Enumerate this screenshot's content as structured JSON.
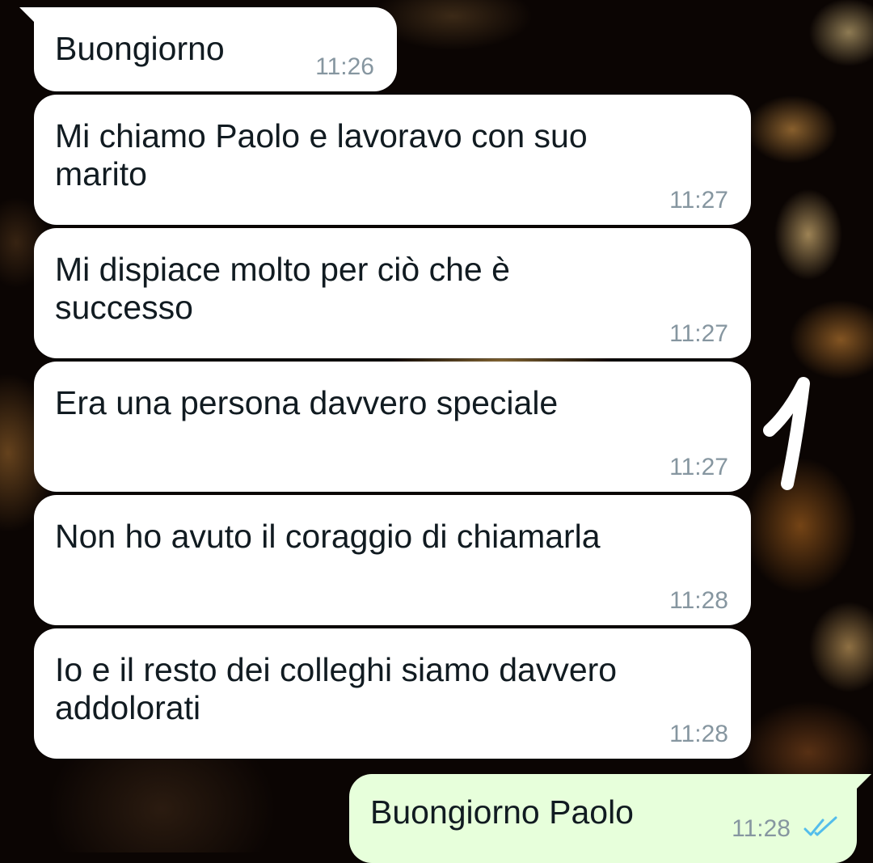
{
  "messages": [
    {
      "direction": "incoming",
      "text": "Buongiorno",
      "time": "11:26"
    },
    {
      "direction": "incoming",
      "text": "Mi chiamo Paolo e lavoravo con suo marito",
      "time": "11:27"
    },
    {
      "direction": "incoming",
      "text": "Mi dispiace molto per ciò che è successo",
      "time": "11:27"
    },
    {
      "direction": "incoming",
      "text": "Era una persona davvero speciale",
      "time": "11:27"
    },
    {
      "direction": "incoming",
      "text": "Non ho avuto il coraggio di chiamarla",
      "time": "11:28"
    },
    {
      "direction": "incoming",
      "text": "Io e il resto dei colleghi siamo davvero addolorati",
      "time": "11:28"
    },
    {
      "direction": "outgoing",
      "text": "Buongiorno Paolo",
      "time": "11:28",
      "status": "read",
      "status_icon": "double-check-icon"
    }
  ],
  "annotation": {
    "text": "1",
    "icon": "handwritten-mark"
  },
  "colors": {
    "incoming_bubble": "#ffffff",
    "outgoing_bubble": "#e7ffdb",
    "text": "#111b21",
    "timestamp": "#8696a0",
    "read_ticks": "#53bdeb"
  }
}
